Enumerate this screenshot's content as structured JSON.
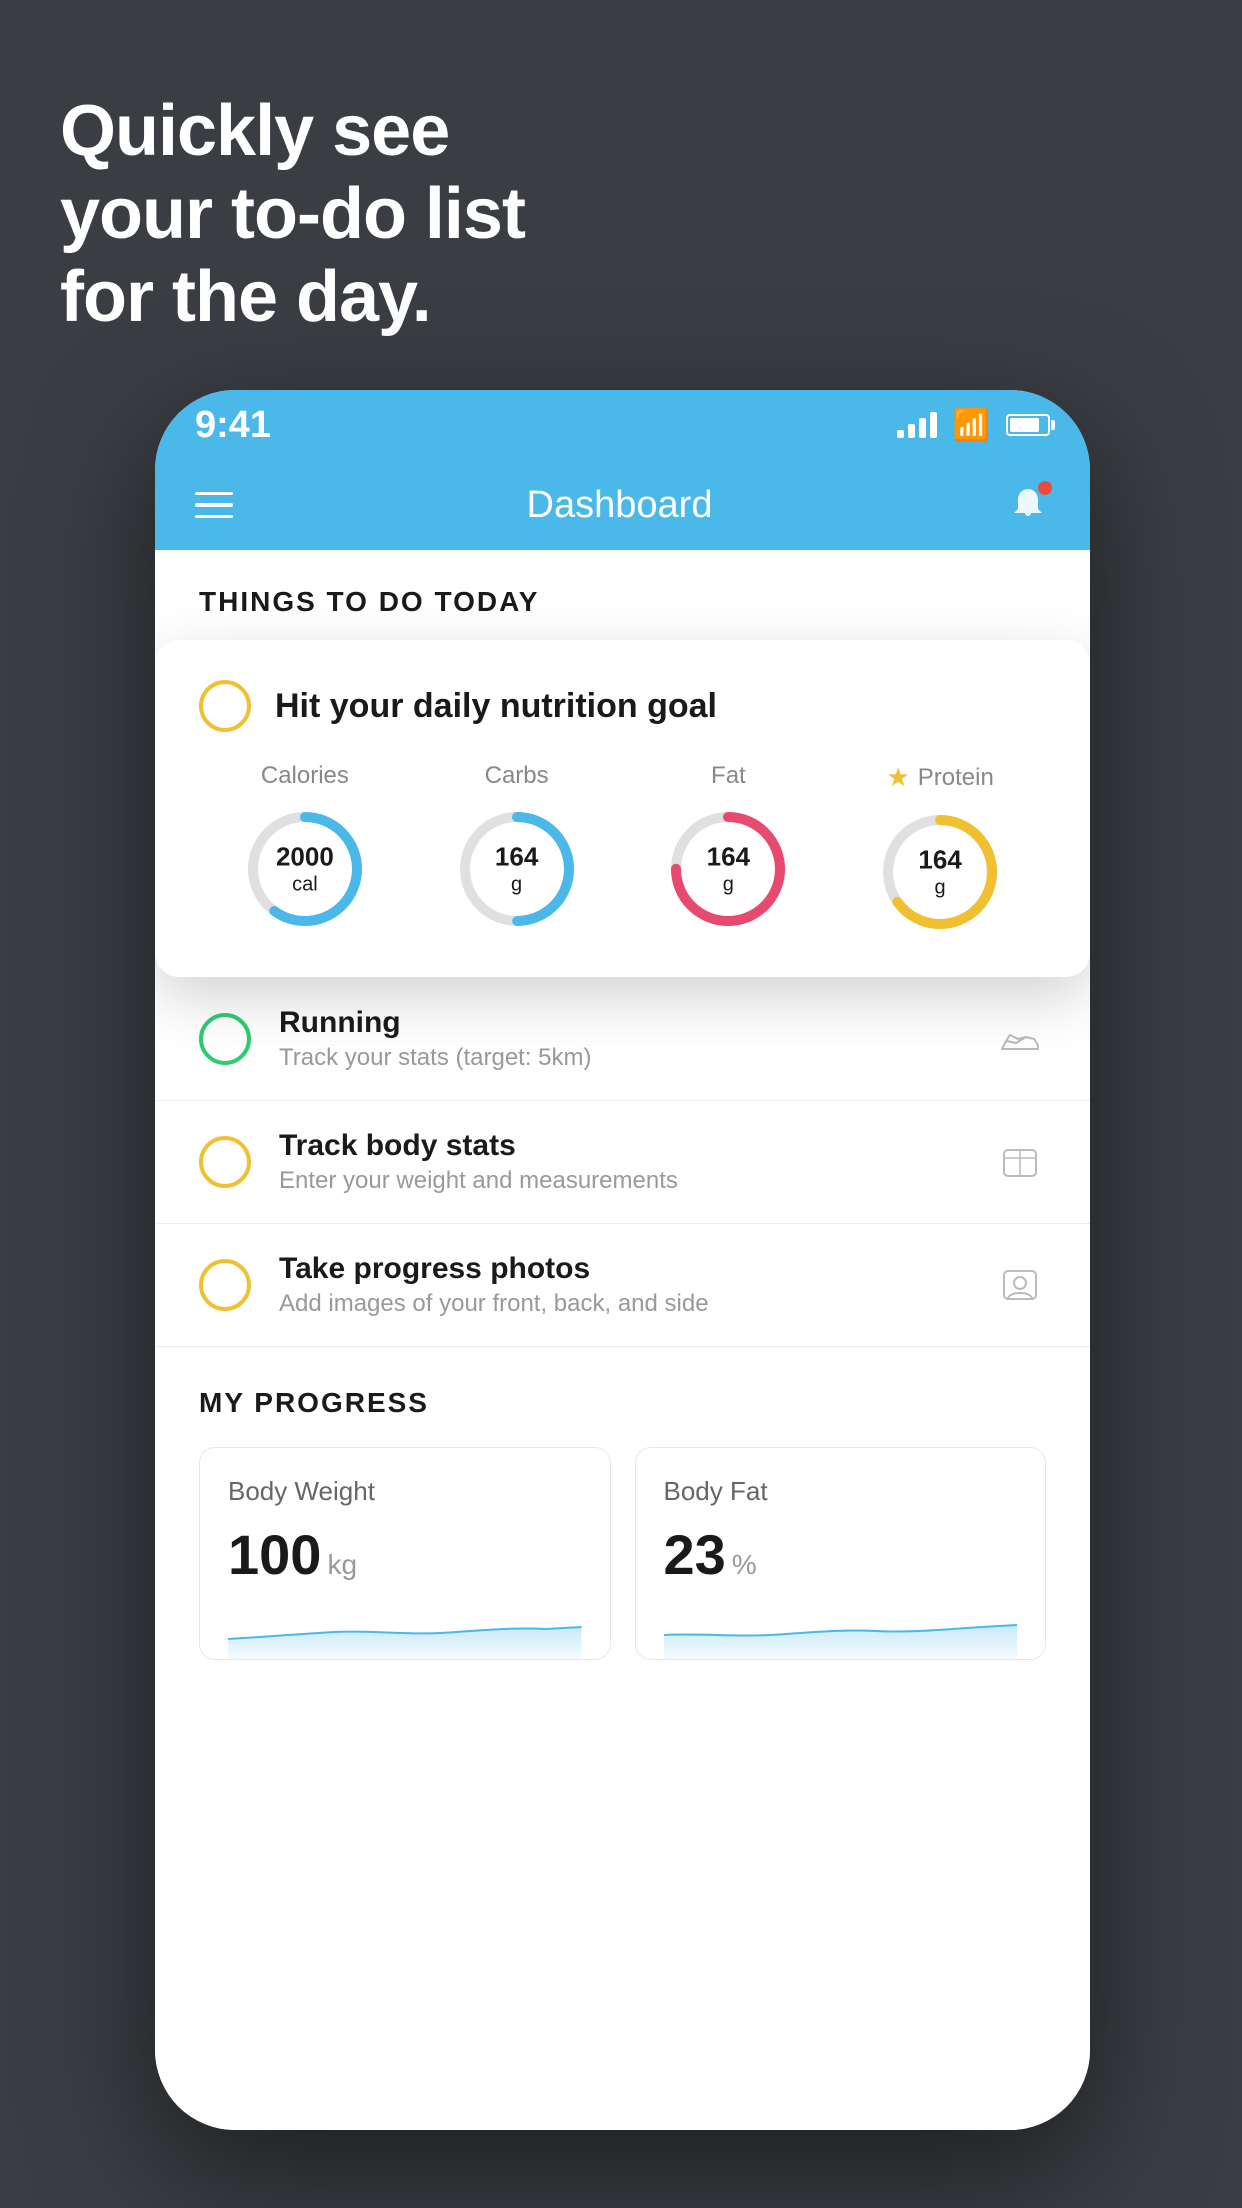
{
  "hero": {
    "line1": "Quickly see",
    "line2": "your to-do list",
    "line3": "for the day."
  },
  "statusBar": {
    "time": "9:41"
  },
  "navBar": {
    "title": "Dashboard"
  },
  "sectionHeader": "THINGS TO DO TODAY",
  "nutritionCard": {
    "checkCircleColor": "#f0c030",
    "title": "Hit your daily nutrition goal",
    "items": [
      {
        "label": "Calories",
        "value": "2000",
        "unit": "cal",
        "color": "#4ab8e8",
        "trackColor": "#e0e0e0",
        "progress": 0.6
      },
      {
        "label": "Carbs",
        "value": "164",
        "unit": "g",
        "color": "#4ab8e8",
        "trackColor": "#e0e0e0",
        "progress": 0.5
      },
      {
        "label": "Fat",
        "value": "164",
        "unit": "g",
        "color": "#e84a6f",
        "trackColor": "#e0e0e0",
        "progress": 0.75
      },
      {
        "label": "Protein",
        "value": "164",
        "unit": "g",
        "color": "#f0c030",
        "trackColor": "#e0e0e0",
        "progress": 0.65,
        "hasStar": true
      }
    ]
  },
  "todoItems": [
    {
      "id": "running",
      "circleType": "green",
      "title": "Running",
      "subtitle": "Track your stats (target: 5km)",
      "icon": "shoe"
    },
    {
      "id": "body-stats",
      "circleType": "yellow",
      "title": "Track body stats",
      "subtitle": "Enter your weight and measurements",
      "icon": "scale"
    },
    {
      "id": "progress-photos",
      "circleType": "yellow",
      "title": "Take progress photos",
      "subtitle": "Add images of your front, back, and side",
      "icon": "person"
    }
  ],
  "progressSection": {
    "header": "MY PROGRESS",
    "cards": [
      {
        "title": "Body Weight",
        "value": "100",
        "unit": "kg"
      },
      {
        "title": "Body Fat",
        "value": "23",
        "unit": "%"
      }
    ]
  }
}
